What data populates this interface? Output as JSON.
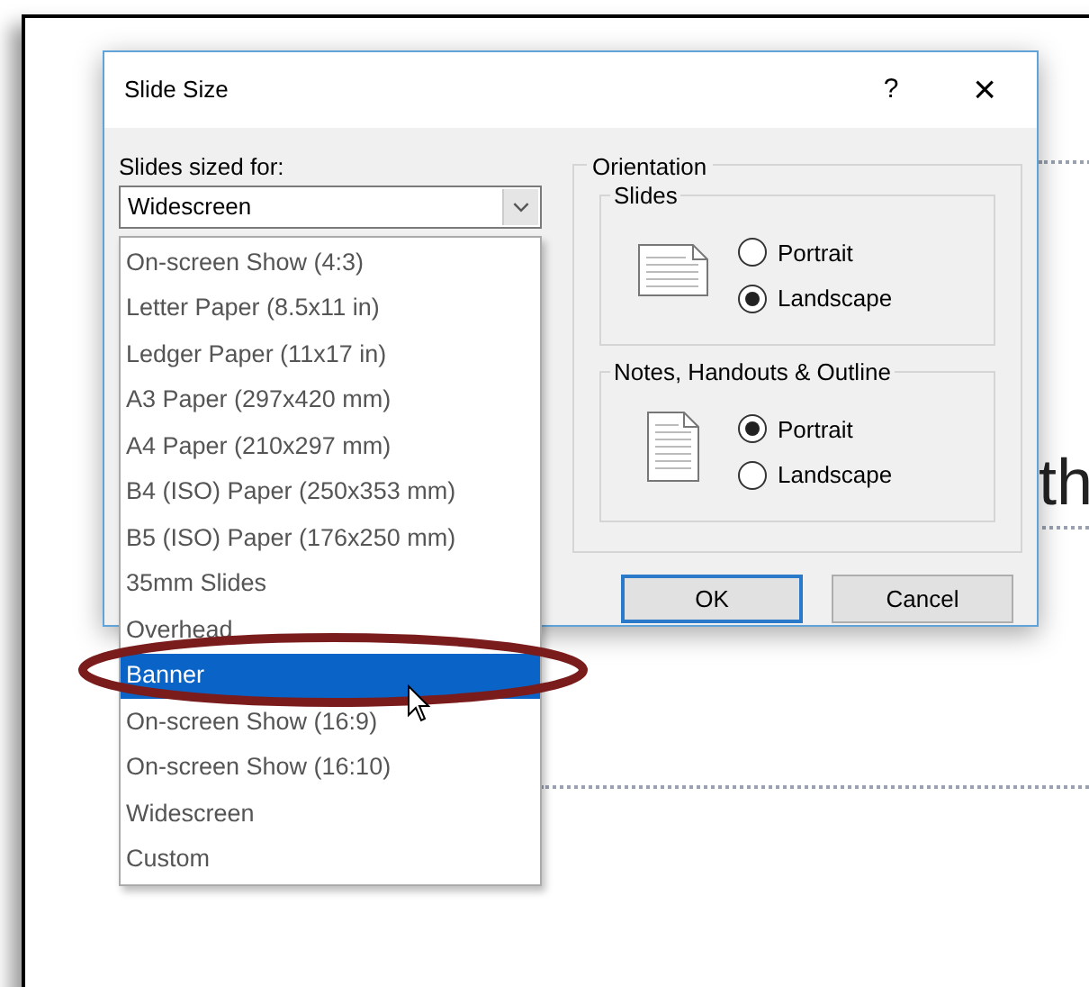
{
  "slide": {
    "text": "th"
  },
  "dialog": {
    "title": "Slide Size",
    "help": "?",
    "close": "×"
  },
  "size": {
    "label": "Slides sized for:",
    "value": "Widescreen",
    "options": [
      {
        "label": "On-screen Show (4:3)",
        "highlighted": false
      },
      {
        "label": "Letter Paper (8.5x11 in)",
        "highlighted": false
      },
      {
        "label": "Ledger Paper (11x17 in)",
        "highlighted": false
      },
      {
        "label": "A3 Paper (297x420 mm)",
        "highlighted": false
      },
      {
        "label": "A4 Paper (210x297 mm)",
        "highlighted": false
      },
      {
        "label": "B4 (ISO) Paper (250x353 mm)",
        "highlighted": false
      },
      {
        "label": "B5 (ISO) Paper (176x250 mm)",
        "highlighted": false
      },
      {
        "label": "35mm Slides",
        "highlighted": false
      },
      {
        "label": "Overhead",
        "highlighted": false
      },
      {
        "label": "Banner",
        "highlighted": true
      },
      {
        "label": "On-screen Show (16:9)",
        "highlighted": false
      },
      {
        "label": "On-screen Show (16:10)",
        "highlighted": false
      },
      {
        "label": "Widescreen",
        "highlighted": false
      },
      {
        "label": "Custom",
        "highlighted": false
      }
    ]
  },
  "orientation": {
    "title": "Orientation",
    "groups": [
      {
        "title": "Slides",
        "kind": "landscape",
        "options": [
          {
            "label": "Portrait",
            "selected": false
          },
          {
            "label": "Landscape",
            "selected": true
          }
        ]
      },
      {
        "title": "Notes, Handouts & Outline",
        "kind": "portrait",
        "options": [
          {
            "label": "Portrait",
            "selected": true
          },
          {
            "label": "Landscape",
            "selected": false
          }
        ]
      }
    ]
  },
  "buttons": [
    {
      "label": "OK",
      "default": true
    },
    {
      "label": "Cancel",
      "default": false
    }
  ]
}
